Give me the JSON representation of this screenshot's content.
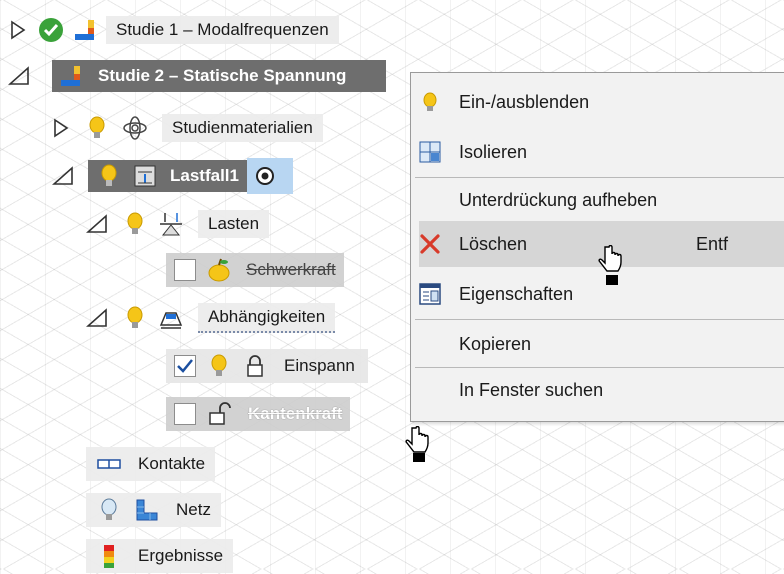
{
  "tree": {
    "study1": "Studie 1 – Modalfrequenzen",
    "study2": "Studie 2 – Statische Spannung",
    "materials": "Studienmaterialien",
    "loadcase": "Lastfall1",
    "loads": "Lasten",
    "gravity": "Schwerkraft",
    "constraints": "Abhängigkeiten",
    "fixed": "Einspann",
    "edgeforce": "Kantenkraft",
    "contacts": "Kontakte",
    "mesh": "Netz",
    "results": "Ergebnisse"
  },
  "context_menu": {
    "items": [
      {
        "label": "Ein-/ausblenden",
        "icon": "lightbulb-icon"
      },
      {
        "label": "Isolieren",
        "icon": "isolate-icon"
      },
      {
        "label": "Unterdrückung aufheben"
      },
      {
        "label": "Löschen",
        "icon": "delete-x-icon",
        "shortcut": "Entf",
        "highlighted": true
      },
      {
        "label": "Eigenschaften",
        "icon": "properties-icon"
      },
      {
        "label": "Kopieren"
      },
      {
        "label": "In Fenster suchen"
      }
    ]
  },
  "colors": {
    "selected_bg": "#6e6e6e",
    "hover_bg": "#d6d6d6",
    "bulb": "#f5c518",
    "delete": "#d83a2a",
    "check_green": "#3aa23a"
  }
}
